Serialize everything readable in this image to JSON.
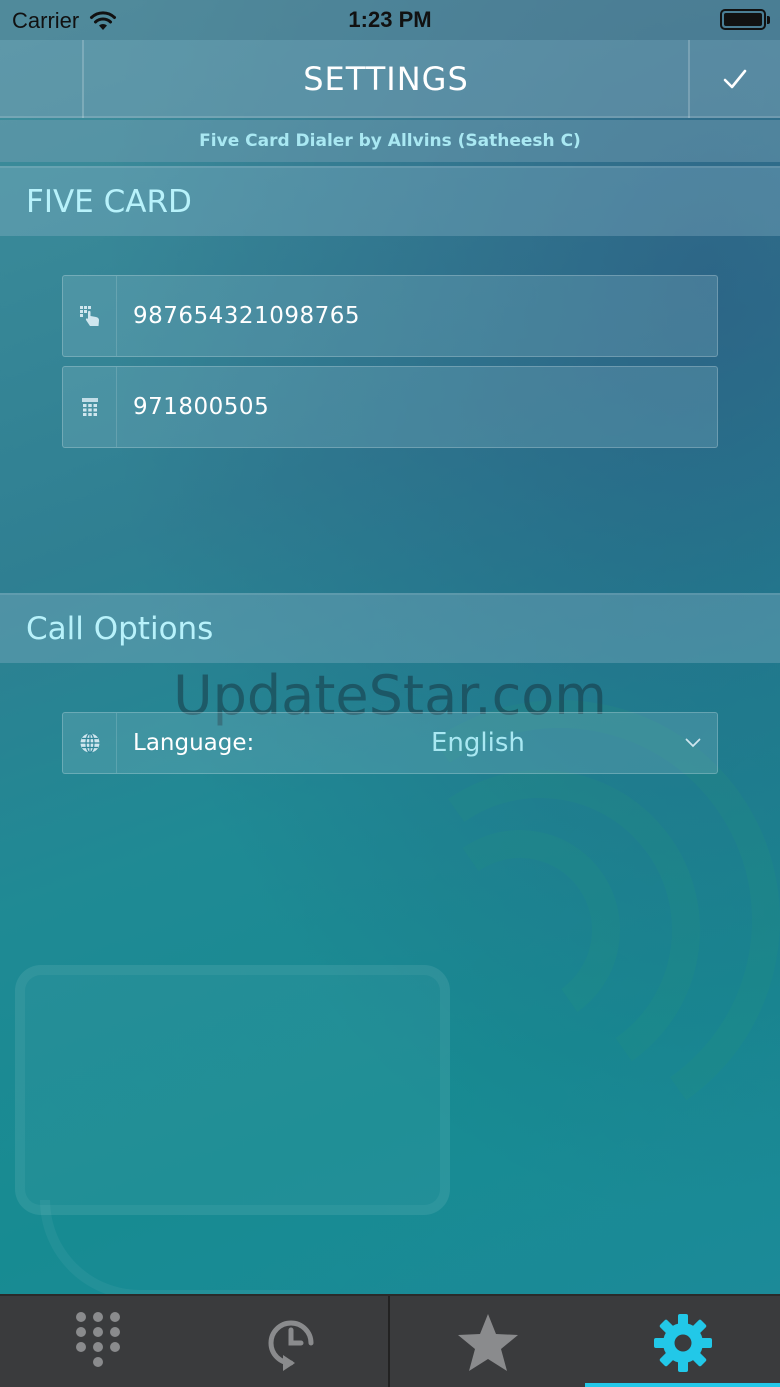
{
  "status_bar": {
    "carrier": "Carrier",
    "time": "1:23 PM"
  },
  "header": {
    "title": "SETTINGS",
    "confirm_icon": "checkmark-icon"
  },
  "subtitle": "Five Card Dialer by Allvins (Satheesh C)",
  "five_card": {
    "heading": "FIVE CARD",
    "fields": [
      {
        "icon": "dialpad-touch-icon",
        "value": "987654321098765"
      },
      {
        "icon": "phone-keypad-icon",
        "value": "971800505"
      }
    ]
  },
  "call_options": {
    "heading": "Call Options",
    "language_label": "Language:",
    "language_value": "English",
    "icon": "globe-icon"
  },
  "watermark": "UpdateStar.com",
  "tabs": [
    {
      "icon": "dialpad-icon",
      "active": false
    },
    {
      "icon": "history-icon",
      "active": false
    },
    {
      "icon": "star-icon",
      "active": false
    },
    {
      "icon": "gear-icon",
      "active": true
    }
  ],
  "colors": {
    "accent": "#22c8e8",
    "section_text": "#b8f2fb",
    "tabbar": "#3a3b3d"
  }
}
